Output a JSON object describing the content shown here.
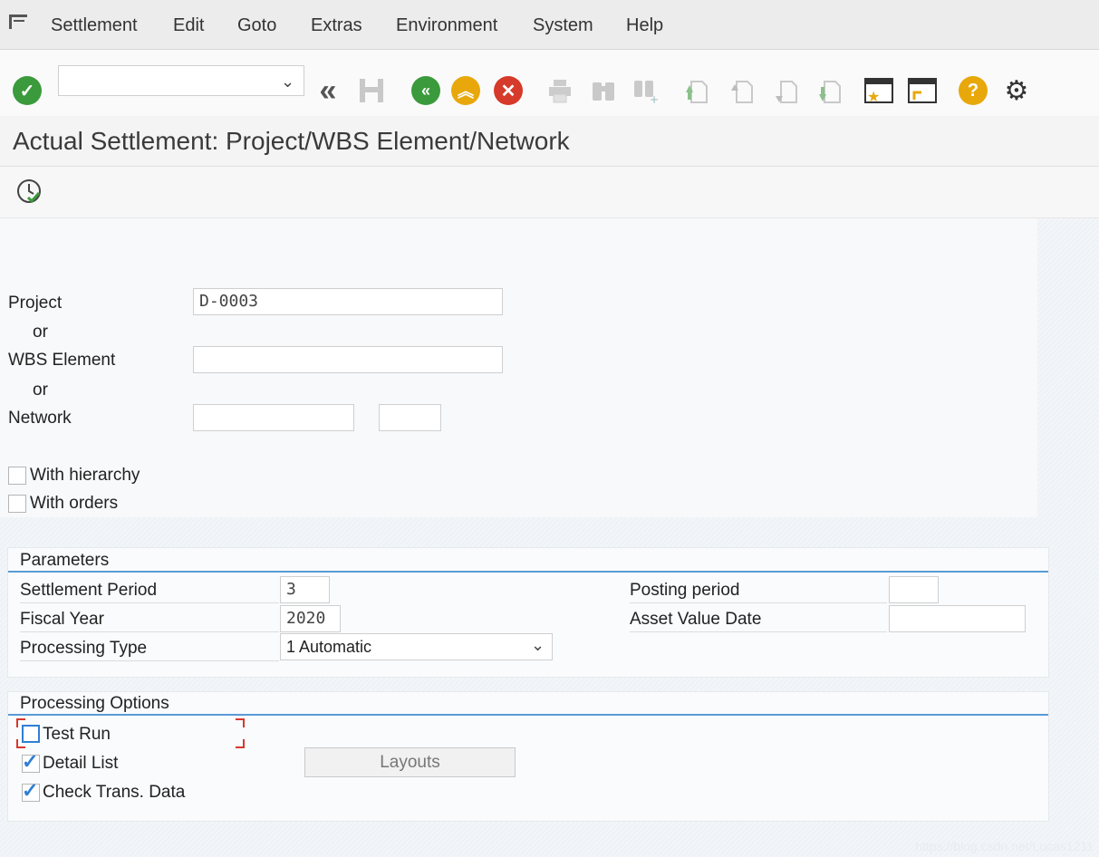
{
  "menu": {
    "items": [
      "Settlement",
      "Edit",
      "Goto",
      "Extras",
      "Environment",
      "System",
      "Help"
    ]
  },
  "toolbar": {
    "command_value": "",
    "icons": [
      "enter-icon",
      "back-double-icon",
      "save-icon",
      "back-icon",
      "exit-icon",
      "cancel-icon",
      "print-icon",
      "find-icon",
      "find-next-icon",
      "first-page-icon",
      "previous-page-icon",
      "next-page-icon",
      "last-page-icon",
      "create-session-icon",
      "shortcut-icon",
      "help-icon",
      "settings-icon"
    ]
  },
  "title": "Actual Settlement: Project/WBS Element/Network",
  "selection": {
    "project_label": "Project",
    "project_value": "D-0003",
    "or1": "or",
    "wbs_label": "WBS Element",
    "wbs_value": "",
    "or2": "or",
    "network_label": "Network",
    "network_value": "",
    "network_op_value": "",
    "with_hierarchy_label": "With hierarchy",
    "with_hierarchy_checked": false,
    "with_orders_label": "With orders",
    "with_orders_checked": false
  },
  "parameters": {
    "title": "Parameters",
    "settlement_period_label": "Settlement Period",
    "settlement_period_value": "3",
    "fiscal_year_label": "Fiscal Year",
    "fiscal_year_value": "2020",
    "processing_type_label": "Processing Type",
    "processing_type_value": "1 Automatic",
    "posting_period_label": "Posting period",
    "posting_period_value": "",
    "asset_value_date_label": "Asset Value Date",
    "asset_value_date_value": ""
  },
  "options": {
    "title": "Processing Options",
    "test_run_label": "Test Run",
    "test_run_checked": false,
    "detail_list_label": "Detail List",
    "detail_list_checked": true,
    "check_trans_label": "Check Trans. Data",
    "check_trans_checked": true,
    "layouts_label": "Layouts"
  },
  "watermark": "https://blog.csdn.net/Lucas1211",
  "colors": {
    "green": "#3b9a3b",
    "orange": "#e8a80c",
    "red": "#d63a2a",
    "accent_line": "#5a9bd5",
    "checkbox_blue": "#2f7fd6"
  }
}
